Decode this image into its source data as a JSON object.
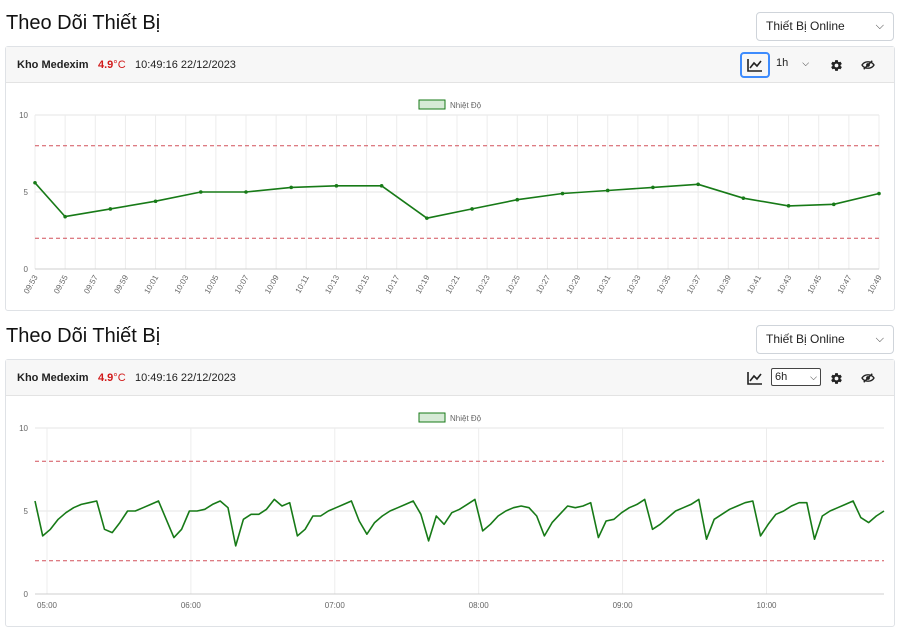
{
  "colors": {
    "series": "#177a17",
    "threshold": "#d2515a",
    "temp_text": "#d11a1a",
    "active_button_border": "#3d8bfd"
  },
  "panels": [
    {
      "title": "Theo Dõi Thiết Bị",
      "device_select": "Thiết Bị Online",
      "location": "Kho Medexim",
      "temp_value": "4.9",
      "temp_unit": "°C",
      "timestamp": "10:49:16 22/12/2023",
      "time_range": "1h",
      "icons": [
        "line-chart-icon",
        "chevron-down-icon",
        "gear-icon",
        "eye-slash-icon"
      ]
    },
    {
      "title": "Theo Dõi Thiết Bị",
      "device_select": "Thiết Bị Online",
      "location": "Kho Medexim",
      "temp_value": "4.9",
      "temp_unit": "°C",
      "timestamp": "10:49:16 22/12/2023",
      "time_range": "6h",
      "icons": [
        "line-chart-icon",
        "chevron-down-icon",
        "gear-icon",
        "eye-slash-icon"
      ]
    }
  ],
  "chart_data": [
    {
      "type": "line",
      "legend": "Nhiệt Độ",
      "ylim": [
        0,
        10
      ],
      "yticks": [
        0,
        5,
        10
      ],
      "grid": true,
      "thresholds": [
        8,
        2
      ],
      "xticks": [
        "09:53",
        "09:55",
        "09:57",
        "09:59",
        "10:01",
        "10:03",
        "10:05",
        "10:07",
        "10:09",
        "10:11",
        "10:13",
        "10:15",
        "10:17",
        "10:19",
        "10:21",
        "10:23",
        "10:25",
        "10:27",
        "10:29",
        "10:31",
        "10:33",
        "10:35",
        "10:37",
        "10:39",
        "10:41",
        "10:43",
        "10:45",
        "10:47",
        "10:49"
      ],
      "series": [
        {
          "name": "Nhiệt Độ",
          "x": [
            "09:53",
            "09:55",
            "09:58",
            "10:01",
            "10:04",
            "10:07",
            "10:10",
            "10:13",
            "10:16",
            "10:19",
            "10:22",
            "10:25",
            "10:28",
            "10:31",
            "10:34",
            "10:37",
            "10:40",
            "10:43",
            "10:46",
            "10:49"
          ],
          "values": [
            5.6,
            3.4,
            3.9,
            4.4,
            5.0,
            5.0,
            5.3,
            5.4,
            5.4,
            3.3,
            3.9,
            4.5,
            4.9,
            5.1,
            5.3,
            5.5,
            4.6,
            4.1,
            4.2,
            4.9
          ]
        }
      ]
    },
    {
      "type": "line",
      "legend": "Nhiệt Độ",
      "ylim": [
        0,
        10
      ],
      "yticks": [
        0,
        5,
        10
      ],
      "grid": true,
      "thresholds": [
        8,
        2
      ],
      "xticks": [
        "05:00",
        "06:00",
        "07:00",
        "08:00",
        "09:00",
        "10:00"
      ],
      "x_start": "04:55",
      "x_end": "10:49",
      "series": [
        {
          "name": "Nhiệt Độ",
          "values": [
            5.6,
            3.5,
            3.9,
            4.5,
            4.9,
            5.2,
            5.4,
            5.5,
            5.6,
            3.9,
            3.7,
            4.3,
            5.0,
            5.0,
            5.2,
            5.4,
            5.6,
            4.5,
            3.4,
            3.9,
            5.0,
            5.0,
            5.1,
            5.4,
            5.6,
            5.2,
            2.9,
            4.5,
            4.8,
            4.8,
            5.1,
            5.7,
            5.3,
            5.5,
            3.5,
            3.9,
            4.7,
            4.7,
            5.0,
            5.2,
            5.4,
            5.6,
            4.4,
            3.6,
            4.3,
            4.7,
            5.0,
            5.2,
            5.4,
            5.6,
            4.8,
            3.2,
            4.7,
            4.2,
            4.9,
            5.1,
            5.4,
            5.7,
            3.8,
            4.2,
            4.7,
            5.0,
            5.2,
            5.3,
            5.2,
            4.7,
            3.5,
            4.3,
            4.8,
            5.3,
            5.2,
            5.3,
            5.5,
            3.4,
            4.4,
            4.5,
            4.9,
            5.2,
            5.4,
            5.7,
            3.9,
            4.2,
            4.6,
            5.0,
            5.2,
            5.4,
            5.7,
            3.3,
            4.5,
            4.8,
            5.1,
            5.3,
            5.5,
            5.6,
            3.5,
            4.2,
            4.8,
            5.0,
            5.3,
            5.5,
            5.5,
            3.3,
            4.7,
            5.0,
            5.2,
            5.4,
            5.6,
            4.6,
            4.3,
            4.7,
            5.0
          ]
        }
      ]
    }
  ]
}
